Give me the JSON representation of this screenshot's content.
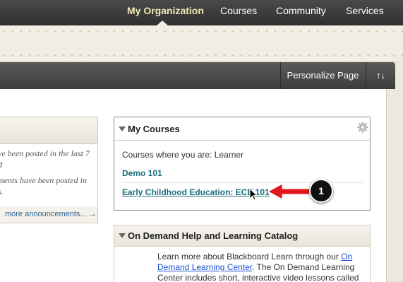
{
  "topnav": {
    "tabs": [
      {
        "label": "My Organization",
        "active": true
      },
      {
        "label": "Courses",
        "active": false
      },
      {
        "label": "Community",
        "active": false
      },
      {
        "label": "Services",
        "active": false
      }
    ]
  },
  "toolbar": {
    "personalize_label": "Personalize Page",
    "reorder_label": "↑↓",
    "reorder_icon": "reorder-arrows-icon"
  },
  "announcements": {
    "lines": [
      "ve been posted in the last 7",
      "d",
      "ments have been posted in",
      "s."
    ],
    "more_label": "more announcements... →"
  },
  "my_courses": {
    "title": "My Courses",
    "gear_icon": "gear-icon",
    "label": "Courses where you are: Learner",
    "courses": [
      {
        "name": "Demo 101"
      },
      {
        "name": "Early Childhood Education: ECE 101"
      }
    ]
  },
  "callout": {
    "number": "1",
    "color": "#e0161b"
  },
  "on_demand": {
    "title": "On Demand Help and Learning Catalog",
    "body_text_1": "Learn more about Blackboard Learn through our ",
    "body_link": "On Demand Learning Center",
    "body_text_2": ". The On Demand Learning Center includes short, interactive video lessons called"
  },
  "colors": {
    "nav_bg": "#333333",
    "active_tab": "#f3e6b8",
    "course_link": "#1d6f80",
    "link_blue": "#1f4fd1"
  }
}
